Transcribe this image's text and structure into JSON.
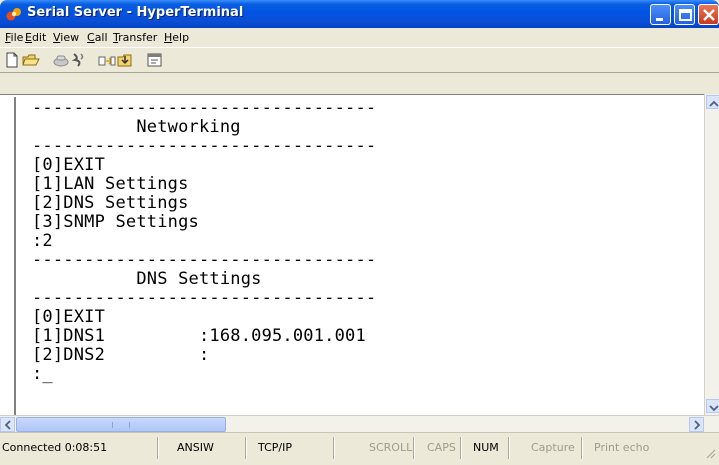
{
  "window": {
    "title": "Serial Server - HyperTerminal",
    "icon": "hyperterminal-icon",
    "accent_color": "#0054e3"
  },
  "menu": {
    "items": [
      {
        "label_ul": "F",
        "label_rest": "ile"
      },
      {
        "label_ul": "E",
        "label_rest": "dit"
      },
      {
        "label_ul": "V",
        "label_rest": "iew"
      },
      {
        "label_ul": "C",
        "label_rest": "all"
      },
      {
        "label_ul": "T",
        "label_rest": "ransfer"
      },
      {
        "label_ul": "H",
        "label_rest": "elp"
      }
    ]
  },
  "toolbar": {
    "icons": [
      "new-document-icon",
      "open-folder-icon",
      "connect-phone-icon",
      "disconnect-icon",
      "send-file-icon",
      "receive-file-icon",
      "properties-icon"
    ]
  },
  "terminal": {
    "lines": [
      "---------------------------------",
      "          Networking",
      "---------------------------------",
      "[0]EXIT",
      "[1]LAN Settings",
      "[2]DNS Settings",
      "[3]SNMP Settings",
      ":2",
      "---------------------------------",
      "          DNS Settings",
      "---------------------------------",
      "[0]EXIT",
      "[1]DNS1         :168.095.001.001",
      "[2]DNS2         :",
      ":_"
    ]
  },
  "statusbar": {
    "connected": "Connected 0:08:51",
    "emulation": "ANSIW",
    "port": "TCP/IP",
    "scroll": "SCROLL",
    "caps": "CAPS",
    "num": "NUM",
    "capture": "Capture",
    "print_echo": "Print echo"
  }
}
